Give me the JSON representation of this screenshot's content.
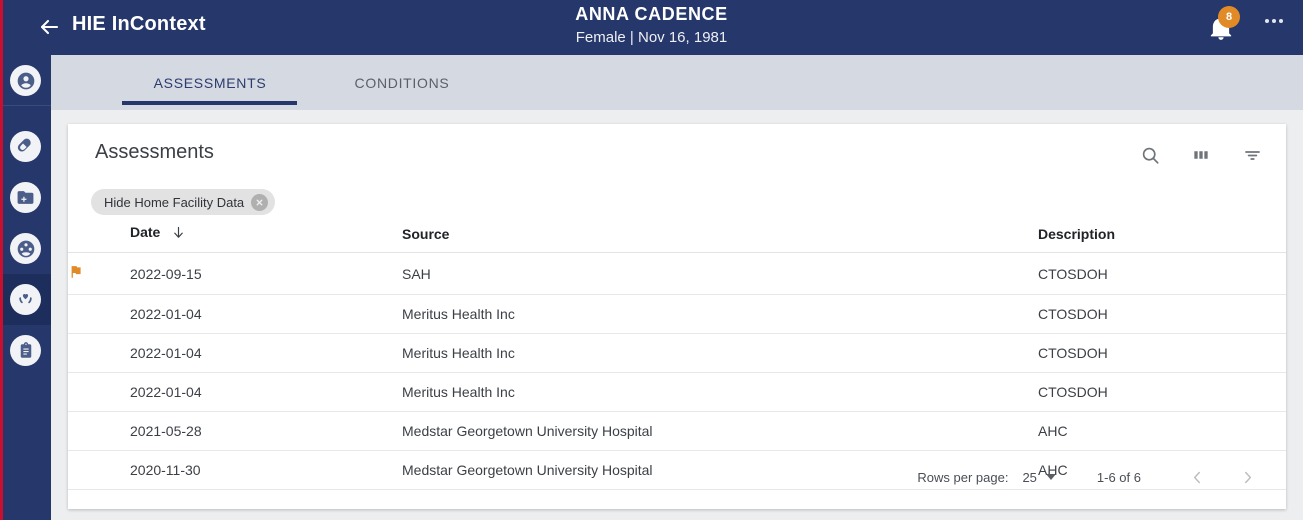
{
  "theme": {
    "navy": "#25376b",
    "red_stripe": "#c8102e",
    "accent_orange": "#e08b28",
    "tabbar_bg": "#d5d9e1",
    "page_bg": "#eceef0"
  },
  "topbar": {
    "back_icon": "arrow-left-icon",
    "app_title": "HIE InContext",
    "patient_name": "ANNA CADENCE",
    "patient_meta": "Female | Nov 16, 1981",
    "bell_icon": "bell-icon",
    "notification_count": "8",
    "overflow_icon": "more-horizontal-icon"
  },
  "sidebar": {
    "items": [
      {
        "name": "sidebar-item-patient",
        "icon": "person-circle-icon",
        "selected": false
      },
      {
        "name": "sidebar-item-medications",
        "icon": "pill-icon",
        "selected": false
      },
      {
        "name": "sidebar-item-records",
        "icon": "folder-plus-icon",
        "selected": false
      },
      {
        "name": "sidebar-item-care-team",
        "icon": "people-group-icon",
        "selected": false
      },
      {
        "name": "sidebar-item-assessments",
        "icon": "heart-hands-icon",
        "selected": true
      },
      {
        "name": "sidebar-item-documents",
        "icon": "clipboard-icon",
        "selected": false
      }
    ]
  },
  "tabs": [
    {
      "label": "ASSESSMENTS",
      "active": true
    },
    {
      "label": "CONDITIONS",
      "active": false
    }
  ],
  "card": {
    "title": "Assessments",
    "actions": [
      {
        "name": "search-icon",
        "label": "search-icon"
      },
      {
        "name": "columns-icon",
        "label": "columns-icon"
      },
      {
        "name": "filter-icon",
        "label": "filter-icon"
      }
    ],
    "chip": {
      "label": "Hide Home Facility Data",
      "remove_icon": "close-icon"
    }
  },
  "table": {
    "columns": [
      "Date",
      "Source",
      "Description"
    ],
    "sort_column": "Date",
    "sort_direction": "descending",
    "sort_icon": "arrow-down-icon",
    "flag_icon": "flag-icon",
    "rows": [
      {
        "flagged": true,
        "date": "2022-09-15",
        "source": "SAH",
        "description": "CTOSDOH"
      },
      {
        "flagged": false,
        "date": "2022-01-04",
        "source": "Meritus Health Inc",
        "description": "CTOSDOH"
      },
      {
        "flagged": false,
        "date": "2022-01-04",
        "source": "Meritus Health Inc",
        "description": "CTOSDOH"
      },
      {
        "flagged": false,
        "date": "2022-01-04",
        "source": "Meritus Health Inc",
        "description": "CTOSDOH"
      },
      {
        "flagged": false,
        "date": "2021-05-28",
        "source": "Medstar Georgetown University Hospital",
        "description": "AHC"
      },
      {
        "flagged": false,
        "date": "2020-11-30",
        "source": "Medstar Georgetown University Hospital",
        "description": "AHC"
      }
    ]
  },
  "paginator": {
    "rows_per_page_label": "Rows per page:",
    "rows_per_page_value": "25",
    "range_label": "1-6 of 6",
    "prev_icon": "chevron-left-icon",
    "next_icon": "chevron-right-icon"
  }
}
